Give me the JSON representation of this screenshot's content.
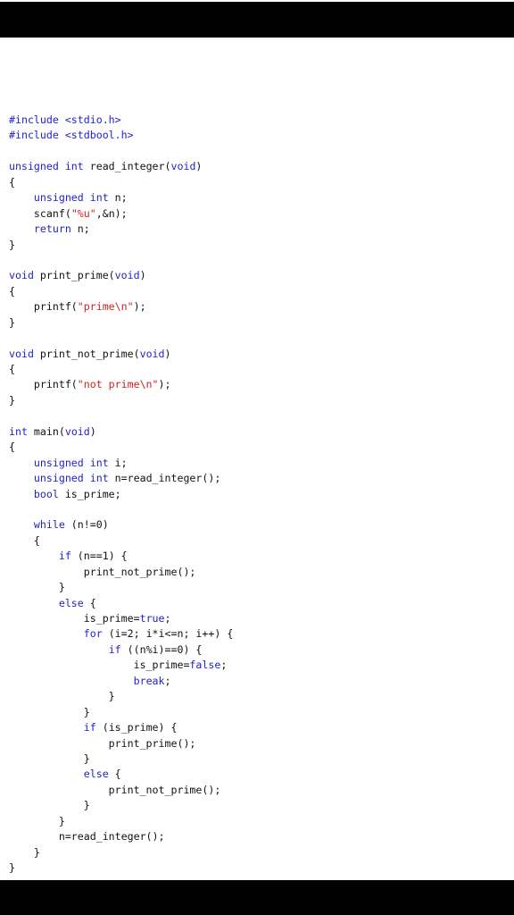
{
  "page": {
    "background_color": "#ffffff",
    "letterbox_color": "#000000",
    "language": "C"
  },
  "theme": {
    "keyword_color": "#2222cc",
    "string_color": "#cc2222",
    "plain_color": "#111111",
    "preprocessor_color": "#2222cc"
  },
  "code": {
    "lines": [
      [
        {
          "t": "#include <stdio.h>",
          "c": "pre"
        }
      ],
      [
        {
          "t": "#include <stdbool.h>",
          "c": "pre"
        }
      ],
      [
        {
          "t": "",
          "c": "plain"
        }
      ],
      [
        {
          "t": "unsigned int",
          "c": "kw"
        },
        {
          "t": " read_integer(",
          "c": "plain"
        },
        {
          "t": "void",
          "c": "kw"
        },
        {
          "t": ")",
          "c": "plain"
        }
      ],
      [
        {
          "t": "{",
          "c": "plain"
        }
      ],
      [
        {
          "t": "    ",
          "c": "plain"
        },
        {
          "t": "unsigned int",
          "c": "kw"
        },
        {
          "t": " n;",
          "c": "plain"
        }
      ],
      [
        {
          "t": "    scanf(",
          "c": "plain"
        },
        {
          "t": "\"%u\"",
          "c": "str"
        },
        {
          "t": ",&n);",
          "c": "plain"
        }
      ],
      [
        {
          "t": "    ",
          "c": "plain"
        },
        {
          "t": "return",
          "c": "kw"
        },
        {
          "t": " n;",
          "c": "plain"
        }
      ],
      [
        {
          "t": "}",
          "c": "plain"
        }
      ],
      [
        {
          "t": "",
          "c": "plain"
        }
      ],
      [
        {
          "t": "void",
          "c": "kw"
        },
        {
          "t": " print_prime(",
          "c": "plain"
        },
        {
          "t": "void",
          "c": "kw"
        },
        {
          "t": ")",
          "c": "plain"
        }
      ],
      [
        {
          "t": "{",
          "c": "plain"
        }
      ],
      [
        {
          "t": "    printf(",
          "c": "plain"
        },
        {
          "t": "\"prime\\n\"",
          "c": "str"
        },
        {
          "t": ");",
          "c": "plain"
        }
      ],
      [
        {
          "t": "}",
          "c": "plain"
        }
      ],
      [
        {
          "t": "",
          "c": "plain"
        }
      ],
      [
        {
          "t": "void",
          "c": "kw"
        },
        {
          "t": " print_not_prime(",
          "c": "plain"
        },
        {
          "t": "void",
          "c": "kw"
        },
        {
          "t": ")",
          "c": "plain"
        }
      ],
      [
        {
          "t": "{",
          "c": "plain"
        }
      ],
      [
        {
          "t": "    printf(",
          "c": "plain"
        },
        {
          "t": "\"not prime\\n\"",
          "c": "str"
        },
        {
          "t": ");",
          "c": "plain"
        }
      ],
      [
        {
          "t": "}",
          "c": "plain"
        }
      ],
      [
        {
          "t": "",
          "c": "plain"
        }
      ],
      [
        {
          "t": "int",
          "c": "kw"
        },
        {
          "t": " main(",
          "c": "plain"
        },
        {
          "t": "void",
          "c": "kw"
        },
        {
          "t": ")",
          "c": "plain"
        }
      ],
      [
        {
          "t": "{",
          "c": "plain"
        }
      ],
      [
        {
          "t": "    ",
          "c": "plain"
        },
        {
          "t": "unsigned int",
          "c": "kw"
        },
        {
          "t": " i;",
          "c": "plain"
        }
      ],
      [
        {
          "t": "    ",
          "c": "plain"
        },
        {
          "t": "unsigned int",
          "c": "kw"
        },
        {
          "t": " n=read_integer();",
          "c": "plain"
        }
      ],
      [
        {
          "t": "    ",
          "c": "plain"
        },
        {
          "t": "bool",
          "c": "kw"
        },
        {
          "t": " is_prime;",
          "c": "plain"
        }
      ],
      [
        {
          "t": "",
          "c": "plain"
        }
      ],
      [
        {
          "t": "    ",
          "c": "plain"
        },
        {
          "t": "while",
          "c": "kw"
        },
        {
          "t": " (n!=0)",
          "c": "plain"
        }
      ],
      [
        {
          "t": "    {",
          "c": "plain"
        }
      ],
      [
        {
          "t": "        ",
          "c": "plain"
        },
        {
          "t": "if",
          "c": "kw"
        },
        {
          "t": " (n==1) {",
          "c": "plain"
        }
      ],
      [
        {
          "t": "            print_not_prime();",
          "c": "plain"
        }
      ],
      [
        {
          "t": "        }",
          "c": "plain"
        }
      ],
      [
        {
          "t": "        ",
          "c": "plain"
        },
        {
          "t": "else",
          "c": "kw"
        },
        {
          "t": " {",
          "c": "plain"
        }
      ],
      [
        {
          "t": "            is_prime=",
          "c": "plain"
        },
        {
          "t": "true",
          "c": "kw"
        },
        {
          "t": ";",
          "c": "plain"
        }
      ],
      [
        {
          "t": "            ",
          "c": "plain"
        },
        {
          "t": "for",
          "c": "kw"
        },
        {
          "t": " (i=2; i*i<=n; i++) {",
          "c": "plain"
        }
      ],
      [
        {
          "t": "                ",
          "c": "plain"
        },
        {
          "t": "if",
          "c": "kw"
        },
        {
          "t": " ((n%i)==0) {",
          "c": "plain"
        }
      ],
      [
        {
          "t": "                    is_prime=",
          "c": "plain"
        },
        {
          "t": "false",
          "c": "kw"
        },
        {
          "t": ";",
          "c": "plain"
        }
      ],
      [
        {
          "t": "                    ",
          "c": "plain"
        },
        {
          "t": "break",
          "c": "kw"
        },
        {
          "t": ";",
          "c": "plain"
        }
      ],
      [
        {
          "t": "                }",
          "c": "plain"
        }
      ],
      [
        {
          "t": "            }",
          "c": "plain"
        }
      ],
      [
        {
          "t": "            ",
          "c": "plain"
        },
        {
          "t": "if",
          "c": "kw"
        },
        {
          "t": " (is_prime) {",
          "c": "plain"
        }
      ],
      [
        {
          "t": "                print_prime();",
          "c": "plain"
        }
      ],
      [
        {
          "t": "            }",
          "c": "plain"
        }
      ],
      [
        {
          "t": "            ",
          "c": "plain"
        },
        {
          "t": "else",
          "c": "kw"
        },
        {
          "t": " {",
          "c": "plain"
        }
      ],
      [
        {
          "t": "                print_not_prime();",
          "c": "plain"
        }
      ],
      [
        {
          "t": "            }",
          "c": "plain"
        }
      ],
      [
        {
          "t": "        }",
          "c": "plain"
        }
      ],
      [
        {
          "t": "        n=read_integer();",
          "c": "plain"
        }
      ],
      [
        {
          "t": "    }",
          "c": "plain"
        }
      ],
      [
        {
          "t": "}",
          "c": "plain"
        }
      ]
    ]
  }
}
